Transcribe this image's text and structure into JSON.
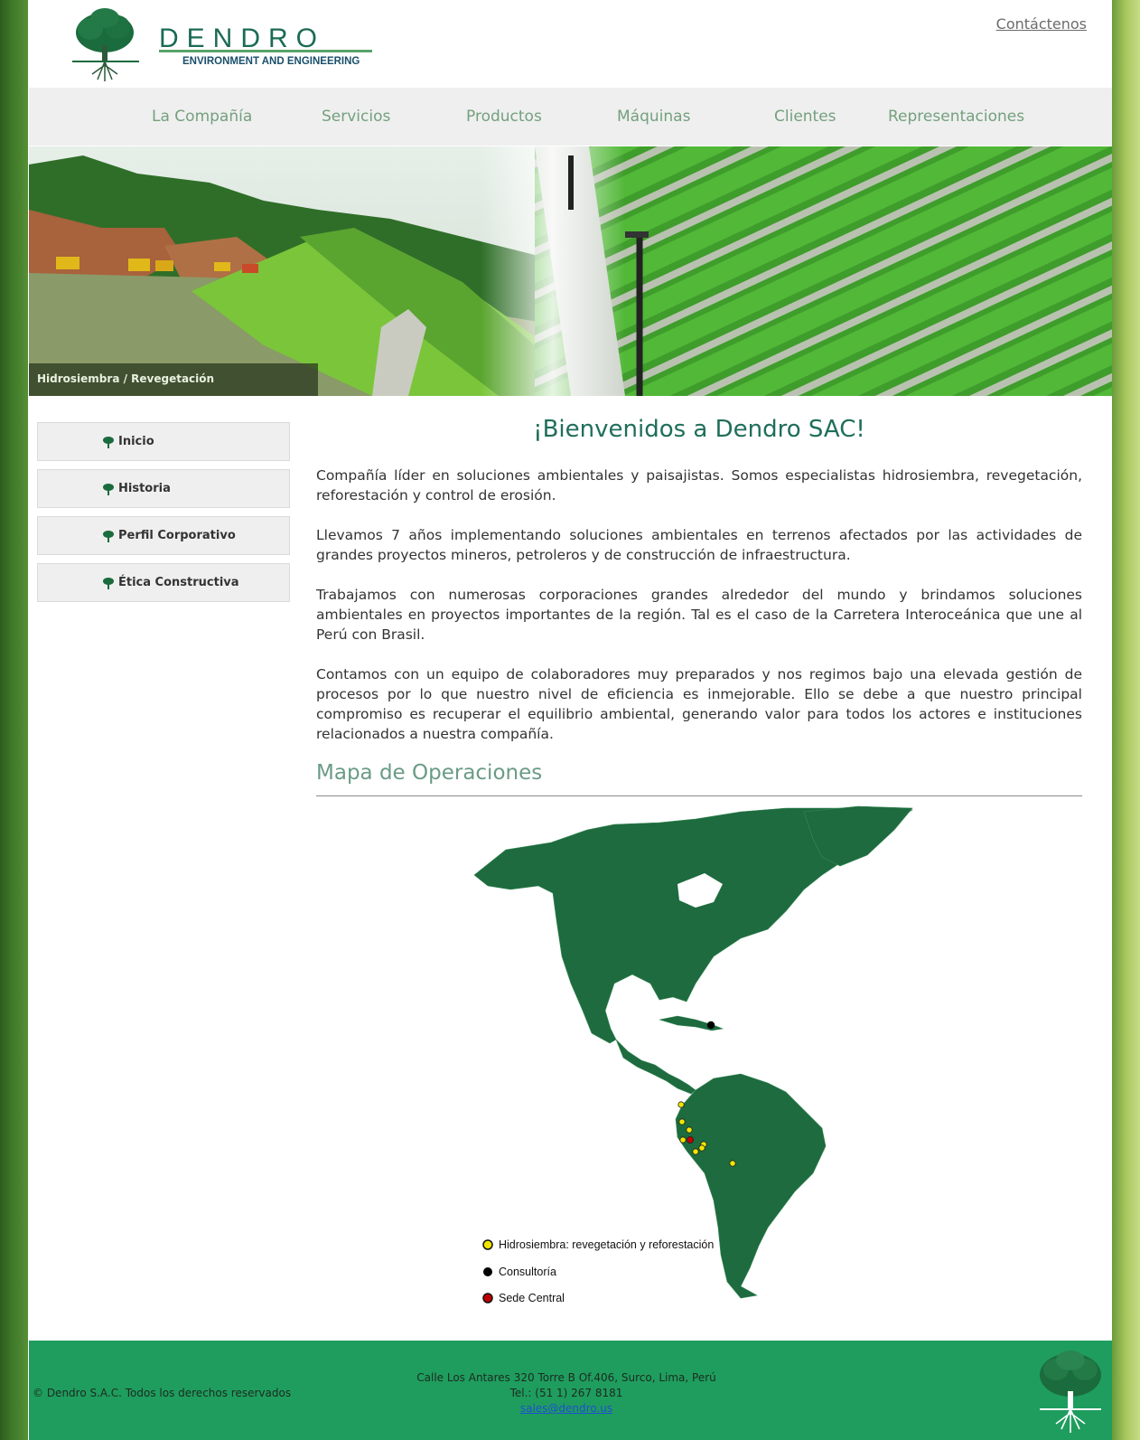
{
  "header": {
    "brand_name": "DENDRO",
    "brand_tagline": "ENVIRONMENT AND ENGINEERING",
    "contact_link": "Contáctenos"
  },
  "nav": {
    "items": [
      {
        "label": "La Compañía"
      },
      {
        "label": "Servicios"
      },
      {
        "label": "Productos"
      },
      {
        "label": "Máquinas"
      },
      {
        "label": "Clientes"
      },
      {
        "label": "Representaciones"
      }
    ]
  },
  "hero": {
    "caption": "Hidrosiembra / Revegetación"
  },
  "sidebar": {
    "items": [
      {
        "label": "Inicio",
        "icon": "tree-icon"
      },
      {
        "label": "Historia",
        "icon": "tree-icon"
      },
      {
        "label": "Perfil Corporativo",
        "icon": "tree-icon"
      },
      {
        "label": "Ética Constructiva",
        "icon": "tree-icon"
      }
    ]
  },
  "main": {
    "title": "¡Bienvenidos a Dendro SAC!",
    "paragraphs": [
      "Compañía líder en soluciones ambientales y paisajistas. Somos especialistas hidrosiembra, revegetación, reforestación y control de erosión.",
      "Llevamos 7 años implementando soluciones ambientales en terrenos afectados por las actividades de grandes proyectos mineros, petroleros y de construcción de infraestructura.",
      "Trabajamos con numerosas corporaciones grandes alrededor del mundo y brindamos soluciones ambientales en proyectos importantes de la región. Tal es el caso de la Carretera Interoceánica que une al Perú con Brasil.",
      "Contamos con un equipo de colaboradores muy preparados y nos regimos bajo una elevada gestión de procesos por lo que nuestro nivel de eficiencia es inmejorable. Ello se debe a que nuestro principal compromiso es recuperar el equilibrio ambiental, generando valor para todos los actores e instituciones relacionados a nuestra compañía."
    ],
    "map_title": "Mapa de Operaciones",
    "map_legend": [
      {
        "label": "Hidrosiembra: revegetación y reforestación",
        "color": "#f2e600"
      },
      {
        "label": "Consultoría",
        "color": "#000000"
      },
      {
        "label": "Sede Central",
        "color": "#c00000"
      }
    ]
  },
  "footer": {
    "copyright": "© Dendro S.A.C. Todos los derechos reservados",
    "address": "Calle Los Antares 320 Torre B Of.406, Surco, Lima, Perú",
    "phone": "Tel.: (51 1) 267 8181",
    "email": "sales@dendro.us"
  },
  "colors": {
    "brand_green": "#1f6e5a",
    "nav_text": "#74a07e",
    "footer_bg": "#1f9d5e",
    "map_land": "#1d6b3e"
  }
}
